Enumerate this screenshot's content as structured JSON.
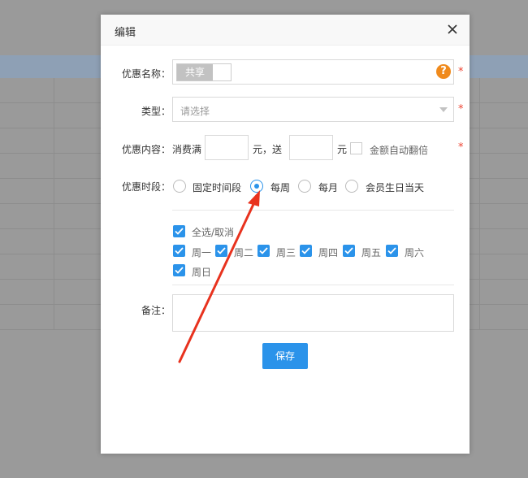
{
  "modal": {
    "title": "编辑",
    "close_icon": "close-icon"
  },
  "form": {
    "name": {
      "label": "优惠名称：",
      "toggle_label": "共享",
      "help_icon": "?"
    },
    "type": {
      "label": "类型：",
      "placeholder": "请选择"
    },
    "content": {
      "label": "优惠内容：",
      "prefix": "消费满",
      "unit1": "元，送",
      "unit2": "元",
      "auto_double_label": "金额自动翻倍",
      "spend_value": "",
      "gift_value": ""
    },
    "period": {
      "label": "优惠时段：",
      "options": [
        "固定时间段",
        "每周",
        "每月",
        "会员生日当天"
      ],
      "selected": "每周"
    },
    "weekdays": {
      "select_all_label": "全选/取消",
      "days": [
        "周一",
        "周二",
        "周三",
        "周四",
        "周五",
        "周六",
        "周日"
      ]
    },
    "remark": {
      "label": "备注：",
      "value": ""
    },
    "required_mark": "*",
    "save_label": "保存"
  },
  "colors": {
    "accent": "#2b93ea",
    "required": "#ee4433",
    "help": "#f08a1c",
    "annotation_arrow": "#e8321e"
  }
}
